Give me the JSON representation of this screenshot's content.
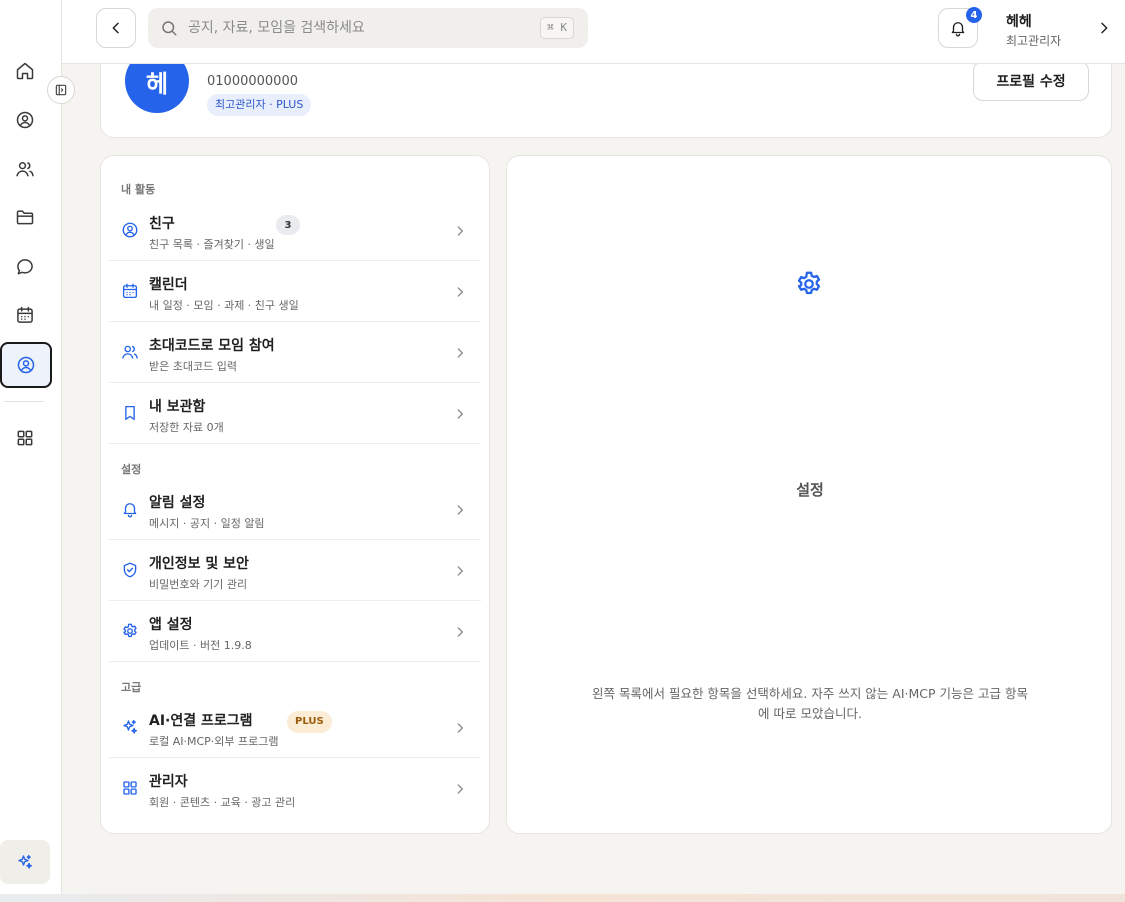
{
  "search": {
    "placeholder": "공지, 자료, 모임을 검색하세요",
    "shortcut": "⌘ K"
  },
  "notifications": {
    "count": "4"
  },
  "user": {
    "name": "헤헤",
    "role": "최고관리자"
  },
  "profile": {
    "avatar_text": "헤",
    "phone": "01000000000",
    "tag": "최고관리자 · PLUS",
    "edit_label": "프로필 수정"
  },
  "sections": {
    "activity": "내 활동",
    "settings": "설정",
    "advanced": "고급"
  },
  "items": {
    "friends": {
      "title": "친구",
      "sub": "친구 목록 · 즐겨찾기 · 생일",
      "badge": "3"
    },
    "calendar": {
      "title": "캘린더",
      "sub": "내 일정 · 모임 · 과제 · 친구 생일"
    },
    "invite": {
      "title": "초대코드로 모임 참여",
      "sub": "받은 초대코드 입력"
    },
    "bookmarks": {
      "title": "내 보관함",
      "sub": "저장한 자료 0개"
    },
    "notify": {
      "title": "알림 설정",
      "sub": "메시지 · 공지 · 일정 알림"
    },
    "privacy": {
      "title": "개인정보 및 보안",
      "sub": "비밀번호와 기기 관리"
    },
    "app": {
      "title": "앱 설정",
      "sub": "업데이트 · 버전 1.9.8"
    },
    "ai": {
      "title": "AI·연결 프로그램",
      "sub": "로컬 AI·MCP·외부 프로그램",
      "badge": "PLUS"
    },
    "admin": {
      "title": "관리자",
      "sub": "회원 · 콘텐츠 · 교육 · 광고 관리"
    }
  },
  "detail": {
    "title": "설정",
    "description": "왼쪽 목록에서 필요한 항목을 선택하세요. 자주 쓰지 않는 AI·MCP 기능은 고급 항목에 따로 모았습니다."
  },
  "icons": {
    "rail": [
      "home-icon",
      "user-circle-icon",
      "users-icon",
      "folder-icon",
      "chat-icon",
      "calendar-icon",
      "profile-icon",
      "grid-icon",
      "sparkle-icon"
    ]
  },
  "colors": {
    "accent": "#2563eb",
    "background": "#f5f4f0",
    "plus_badge": "#fbecd5"
  }
}
